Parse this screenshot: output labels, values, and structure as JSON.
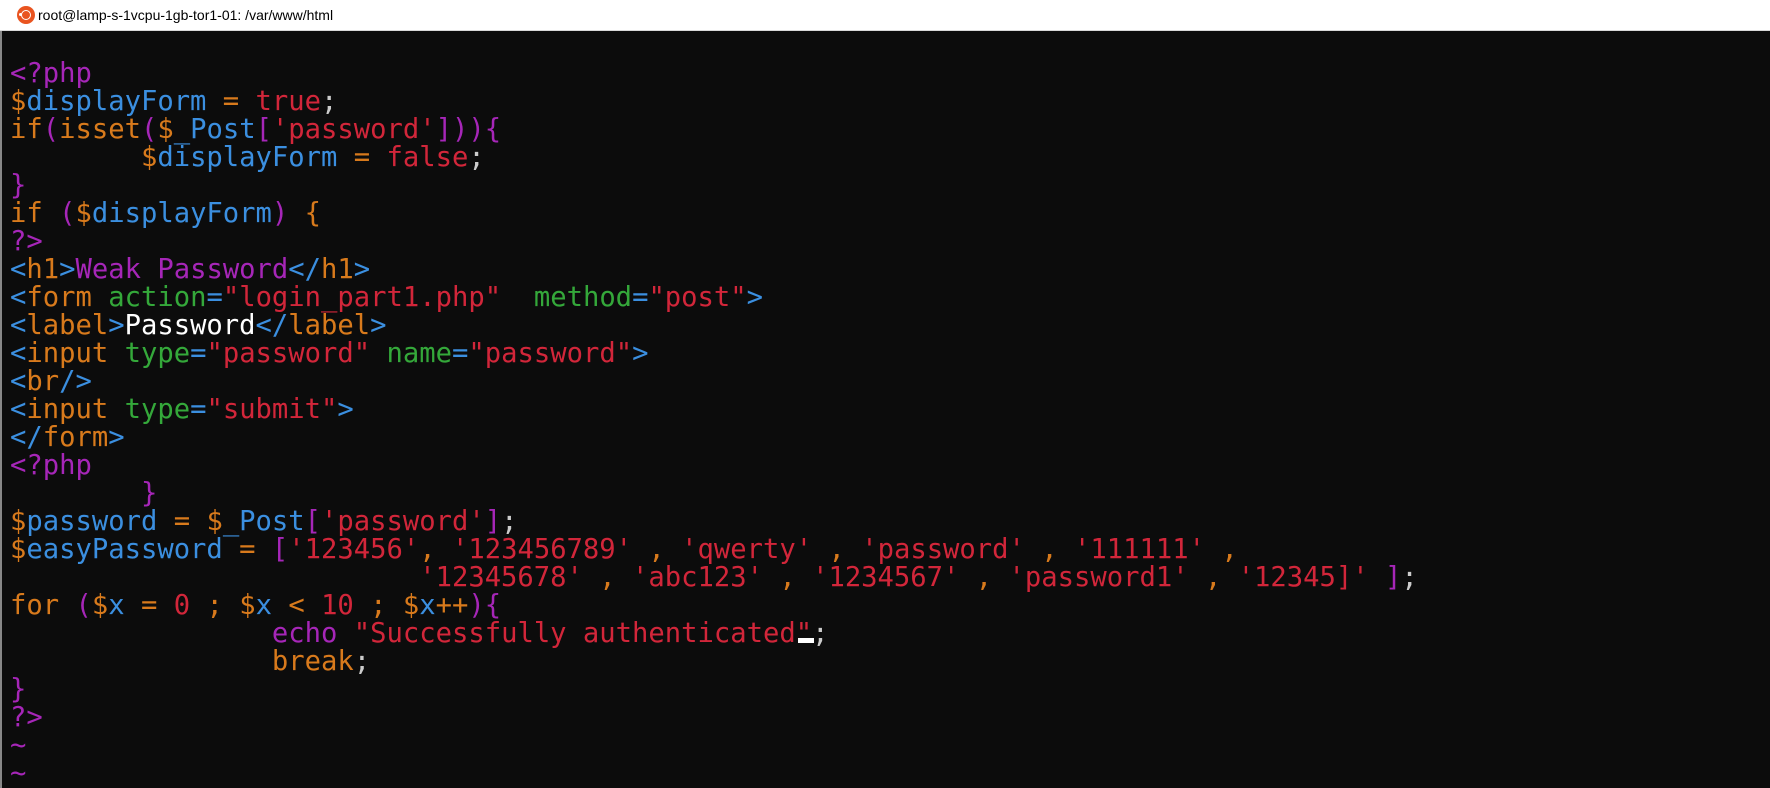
{
  "window": {
    "title": "root@lamp-s-1vcpu-1gb-tor1-01: /var/www/html"
  },
  "colors": {
    "background": "#0c0c0c",
    "purple": "#a626b8",
    "blue": "#3b8fe0",
    "red": "#d2263a",
    "orange": "#d87a1c",
    "green": "#34a83a",
    "white": "#ffffff",
    "gray": "#cccccc"
  },
  "editor": {
    "lines": [
      [
        [
          "<?php",
          "purple"
        ]
      ],
      [
        [
          "$",
          "orange"
        ],
        [
          "displayForm",
          "blue"
        ],
        [
          " = ",
          "orange"
        ],
        [
          "true",
          "red"
        ],
        [
          ";",
          "gray"
        ]
      ],
      [
        [
          "if",
          "orange"
        ],
        [
          "(",
          "purple"
        ],
        [
          "isset",
          "orange"
        ],
        [
          "(",
          "purple"
        ],
        [
          "$",
          "orange"
        ],
        [
          "_Post",
          "blue"
        ],
        [
          "[",
          "purple"
        ],
        [
          "'password'",
          "red"
        ],
        [
          "]",
          "purple"
        ],
        [
          ")",
          "purple"
        ],
        [
          ")",
          "purple"
        ],
        [
          "{",
          "purple"
        ]
      ],
      [
        [
          "        ",
          "gray"
        ],
        [
          "$",
          "orange"
        ],
        [
          "displayForm",
          "blue"
        ],
        [
          " = ",
          "orange"
        ],
        [
          "false",
          "red"
        ],
        [
          ";",
          "gray"
        ]
      ],
      [
        [
          "}",
          "purple"
        ]
      ],
      [
        [
          "if ",
          "orange"
        ],
        [
          "(",
          "purple"
        ],
        [
          "$",
          "orange"
        ],
        [
          "displayForm",
          "blue"
        ],
        [
          ") ",
          "purple"
        ],
        [
          "{",
          "orange"
        ]
      ],
      [
        [
          "?>",
          "purple"
        ]
      ],
      [
        [
          "<",
          "blue"
        ],
        [
          "h1",
          "orange"
        ],
        [
          ">",
          "blue"
        ],
        [
          "Weak Password",
          "purple"
        ],
        [
          "</",
          "blue"
        ],
        [
          "h1",
          "orange"
        ],
        [
          ">",
          "blue"
        ]
      ],
      [
        [
          "<",
          "blue"
        ],
        [
          "form",
          "orange"
        ],
        [
          " ",
          "gray"
        ],
        [
          "action",
          "green"
        ],
        [
          "=",
          "blue"
        ],
        [
          "\"login_part1.php\"",
          "red"
        ],
        [
          "  ",
          "gray"
        ],
        [
          "method",
          "green"
        ],
        [
          "=",
          "blue"
        ],
        [
          "\"post\"",
          "red"
        ],
        [
          ">",
          "blue"
        ]
      ],
      [
        [
          "<",
          "blue"
        ],
        [
          "label",
          "orange"
        ],
        [
          ">",
          "blue"
        ],
        [
          "Password",
          "white"
        ],
        [
          "</",
          "blue"
        ],
        [
          "label",
          "orange"
        ],
        [
          ">",
          "blue"
        ]
      ],
      [
        [
          "<",
          "blue"
        ],
        [
          "input",
          "orange"
        ],
        [
          " ",
          "gray"
        ],
        [
          "type",
          "green"
        ],
        [
          "=",
          "blue"
        ],
        [
          "\"password\"",
          "red"
        ],
        [
          " ",
          "gray"
        ],
        [
          "name",
          "green"
        ],
        [
          "=",
          "blue"
        ],
        [
          "\"password\"",
          "red"
        ],
        [
          ">",
          "blue"
        ]
      ],
      [
        [
          "<",
          "blue"
        ],
        [
          "br",
          "orange"
        ],
        [
          "/>",
          "blue"
        ]
      ],
      [
        [
          "<",
          "blue"
        ],
        [
          "input",
          "orange"
        ],
        [
          " ",
          "gray"
        ],
        [
          "type",
          "green"
        ],
        [
          "=",
          "blue"
        ],
        [
          "\"submit\"",
          "red"
        ],
        [
          ">",
          "blue"
        ]
      ],
      [
        [
          "</",
          "blue"
        ],
        [
          "form",
          "orange"
        ],
        [
          ">",
          "blue"
        ]
      ],
      [
        [
          "<?php",
          "purple"
        ]
      ],
      [
        [
          "        ",
          "gray"
        ],
        [
          "}",
          "purple"
        ]
      ],
      [
        [
          "$",
          "orange"
        ],
        [
          "password",
          "blue"
        ],
        [
          " = ",
          "orange"
        ],
        [
          "$",
          "orange"
        ],
        [
          "_Post",
          "blue"
        ],
        [
          "[",
          "purple"
        ],
        [
          "'password'",
          "red"
        ],
        [
          "]",
          "purple"
        ],
        [
          ";",
          "gray"
        ]
      ],
      [
        [
          "$",
          "orange"
        ],
        [
          "easyPassword",
          "blue"
        ],
        [
          " = ",
          "orange"
        ],
        [
          "[",
          "purple"
        ],
        [
          "'123456'",
          "red"
        ],
        [
          ", ",
          "orange"
        ],
        [
          "'123456789'",
          "red"
        ],
        [
          " , ",
          "orange"
        ],
        [
          "'qwerty'",
          "red"
        ],
        [
          " , ",
          "orange"
        ],
        [
          "'password'",
          "red"
        ],
        [
          " , ",
          "orange"
        ],
        [
          "'111111'",
          "red"
        ],
        [
          " ,",
          "orange"
        ]
      ],
      [
        [
          "                         ",
          "gray"
        ],
        [
          "'12345678'",
          "red"
        ],
        [
          " , ",
          "orange"
        ],
        [
          "'abc123'",
          "red"
        ],
        [
          " , ",
          "orange"
        ],
        [
          "'1234567'",
          "red"
        ],
        [
          " , ",
          "orange"
        ],
        [
          "'password1'",
          "red"
        ],
        [
          " , ",
          "orange"
        ],
        [
          "'12345]'",
          "red"
        ],
        [
          " ",
          "gray"
        ],
        [
          "]",
          "purple"
        ],
        [
          ";",
          "gray"
        ]
      ],
      [
        [
          "for ",
          "orange"
        ],
        [
          "(",
          "purple"
        ],
        [
          "$",
          "orange"
        ],
        [
          "x",
          "blue"
        ],
        [
          " = ",
          "orange"
        ],
        [
          "0",
          "red"
        ],
        [
          " ; ",
          "orange"
        ],
        [
          "$",
          "orange"
        ],
        [
          "x",
          "blue"
        ],
        [
          " < ",
          "orange"
        ],
        [
          "10",
          "red"
        ],
        [
          " ; ",
          "orange"
        ],
        [
          "$",
          "orange"
        ],
        [
          "x",
          "blue"
        ],
        [
          "++",
          "orange"
        ],
        [
          ")",
          "purple"
        ],
        [
          "{",
          "purple"
        ]
      ],
      [
        [
          "                ",
          "gray"
        ],
        [
          "echo",
          "purple"
        ],
        [
          " ",
          "gray"
        ],
        [
          "\"Successfully authenticated",
          "red"
        ],
        [
          "CURSOR",
          "cursor"
        ],
        [
          "\"",
          "red"
        ],
        [
          ";",
          "gray"
        ]
      ],
      [
        [
          "                ",
          "gray"
        ],
        [
          "break",
          "orange"
        ],
        [
          ";",
          "gray"
        ]
      ],
      [
        [
          "}",
          "purple"
        ]
      ],
      [
        [
          "?>",
          "purple"
        ]
      ],
      [
        [
          "~",
          "purple"
        ]
      ],
      [
        [
          "~",
          "purple"
        ]
      ]
    ]
  }
}
